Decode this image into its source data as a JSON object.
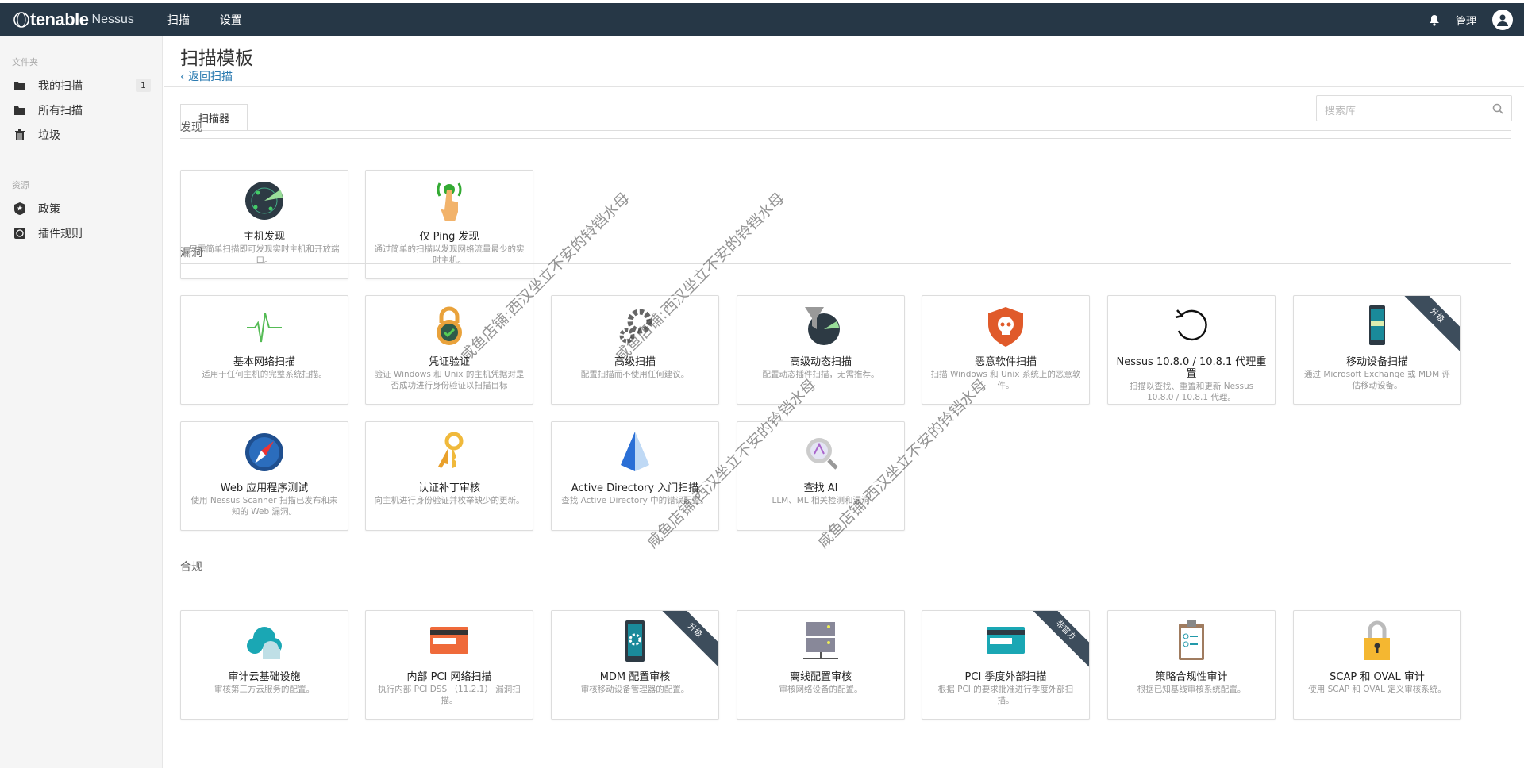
{
  "header": {
    "brand": "tenable",
    "product": "Nessus",
    "nav": [
      "扫描",
      "设置"
    ],
    "user": "管理"
  },
  "sidebar": {
    "folders_heading": "文件夹",
    "folders": [
      {
        "label": "我的扫描",
        "count": "1"
      },
      {
        "label": "所有扫描"
      },
      {
        "label": "垃圾"
      }
    ],
    "resources_heading": "资源",
    "resources": [
      {
        "label": "政策"
      },
      {
        "label": "插件规则"
      }
    ]
  },
  "page": {
    "title": "扫描模板",
    "back": "返回扫描",
    "tab": "扫描器",
    "search_placeholder": "搜索库"
  },
  "sections": [
    {
      "title": "发现",
      "cards": [
        {
          "name": "主机发现",
          "desc": "只需简单扫描即可发现实时主机和开放端口。",
          "icon": "radar-icon"
        },
        {
          "name": "仅 Ping 发现",
          "desc": "通过简单的扫描以发现网络流量最少的实时主机。",
          "icon": "ping-hand-icon"
        }
      ]
    },
    {
      "title": "漏洞",
      "cards": [
        {
          "name": "基本网络扫描",
          "desc": "适用于任何主机的完整系统扫描。",
          "icon": "pulse-icon"
        },
        {
          "name": "凭证验证",
          "desc": "验证 Windows 和 Unix 的主机凭据对是否成功进行身份验证以扫描目标",
          "icon": "padlock-check-icon"
        },
        {
          "name": "高级扫描",
          "desc": "配置扫描而不使用任何建议。",
          "icon": "gears-icon"
        },
        {
          "name": "高级动态扫描",
          "desc": "配置动态插件扫描，无需推荐。",
          "icon": "filter-radar-icon"
        },
        {
          "name": "恶意软件扫描",
          "desc": "扫描 Windows 和 Unix 系统上的恶意软件。",
          "icon": "skull-shield-icon"
        },
        {
          "name": "Nessus 10.8.0 / 10.8.1 代理重置",
          "desc": "扫描以查找、重置和更新 Nessus 10.8.0 / 10.8.1 代理。",
          "icon": "reset-icon"
        },
        {
          "name": "移动设备扫描",
          "desc": "通过 Microsoft Exchange 或 MDM 评估移动设备。",
          "icon": "mobile-icon",
          "ribbon": "升级"
        },
        {
          "name": "Web 应用程序测试",
          "desc": "使用 Nessus Scanner 扫描已发布和未知的 Web 漏洞。",
          "icon": "compass-icon"
        },
        {
          "name": "认证补丁审核",
          "desc": "向主机进行身份验证并枚举缺少的更新。",
          "icon": "keys-icon"
        },
        {
          "name": "Active Directory 入门扫描",
          "desc": "查找 Active Directory 中的错误配置。",
          "icon": "pyramid-icon"
        },
        {
          "name": "查找 AI",
          "desc": "LLM、ML 相关检测和漏洞",
          "icon": "ai-search-icon"
        }
      ]
    },
    {
      "title": "合规",
      "cards": [
        {
          "name": "审计云基础设施",
          "desc": "审核第三方云服务的配置。",
          "icon": "cloud-icon"
        },
        {
          "name": "内部 PCI 网络扫描",
          "desc": "执行内部 PCI DSS （11.2.1） 漏洞扫描。",
          "icon": "credit-card-orange-icon"
        },
        {
          "name": "MDM 配置审核",
          "desc": "审核移动设备管理器的配置。",
          "icon": "mobile-gear-icon",
          "ribbon": "升级"
        },
        {
          "name": "离线配置审核",
          "desc": "审核网络设备的配置。",
          "icon": "server-icon"
        },
        {
          "name": "PCI 季度外部扫描",
          "desc": "根据 PCI 的要求批准进行季度外部扫描。",
          "icon": "credit-card-teal-icon",
          "ribbon": "非官方"
        },
        {
          "name": "策略合规性审计",
          "desc": "根据已知基线审核系统配置。",
          "icon": "clipboard-icon"
        },
        {
          "name": "SCAP 和 OVAL 审计",
          "desc": "使用 SCAP 和 OVAL 定义审核系统。",
          "icon": "yellow-padlock-icon"
        }
      ]
    }
  ],
  "watermark": "咸鱼店铺:西汉坐立不安的铃铛水母",
  "colors": {
    "header": "#263746",
    "link": "#2a7ab0",
    "ribbon": "#3d4d5c"
  }
}
